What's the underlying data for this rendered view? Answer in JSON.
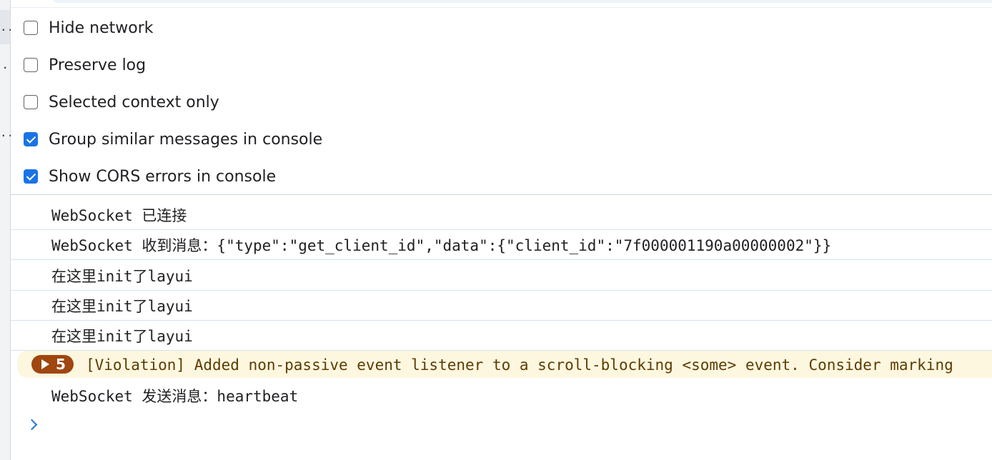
{
  "gutter": {
    "dots": [
      "..",
      ".",
      ".."
    ]
  },
  "settings": {
    "items": [
      {
        "label": "Hide network",
        "checked": false
      },
      {
        "label": "Preserve log",
        "checked": false
      },
      {
        "label": "Selected context only",
        "checked": false
      },
      {
        "label": "Group similar messages in console",
        "checked": true
      },
      {
        "label": "Show CORS errors in console",
        "checked": true
      }
    ]
  },
  "console": {
    "messages": [
      {
        "text": "WebSocket 已连接"
      },
      {
        "text": "WebSocket 收到消息：{\"type\":\"get_client_id\",\"data\":{\"client_id\":\"7f000001190a00000002\"}}"
      },
      {
        "text": "在这里init了layui"
      },
      {
        "text": "在这里init了layui"
      },
      {
        "text": "在这里init了layui"
      }
    ],
    "warning": {
      "repeat_count": "5",
      "text": "[Violation] Added non-passive event listener to a scroll-blocking <some> event. Consider marking"
    },
    "last_message": {
      "text": "WebSocket 发送消息：heartbeat"
    }
  },
  "colors": {
    "accent": "#1a73e8",
    "warning_bg": "#fef7e0",
    "warning_badge": "#a0460f",
    "warning_text": "#5c3c00"
  }
}
